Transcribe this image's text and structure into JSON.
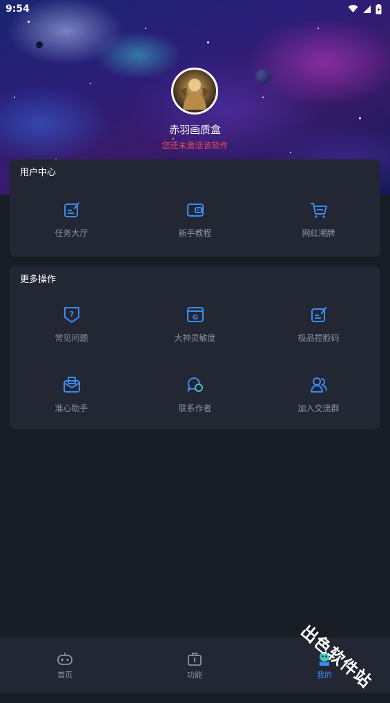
{
  "status_bar": {
    "time": "9:54",
    "icons": [
      "wifi-icon",
      "signal-icon",
      "battery-icon"
    ]
  },
  "profile": {
    "name": "赤羽画质盒",
    "subtitle": "您还未激活该软件"
  },
  "user_center": {
    "title": "用户中心",
    "items": [
      {
        "label": "任务大厅",
        "icon": "task-edit-icon"
      },
      {
        "label": "新手教程",
        "icon": "wallet-icon"
      },
      {
        "label": "网红潮牌",
        "icon": "cart-icon"
      }
    ]
  },
  "more_actions": {
    "title": "更多操作",
    "items": [
      {
        "label": "常见问题",
        "icon": "question-shield-icon"
      },
      {
        "label": "大神灵敏度",
        "icon": "g-browser-icon"
      },
      {
        "label": "极品捏脸码",
        "icon": "edit-note-icon"
      },
      {
        "label": "准心助手",
        "icon": "mailbox-icon"
      },
      {
        "label": "联系作者",
        "icon": "chat-bubble-icon"
      },
      {
        "label": "加入交流群",
        "icon": "group-users-icon"
      }
    ]
  },
  "bottom_nav": {
    "items": [
      {
        "label": "首页",
        "icon": "gamepad-icon",
        "active": false
      },
      {
        "label": "功能",
        "icon": "toolbox-icon",
        "active": false
      },
      {
        "label": "我的",
        "icon": "profile-mascot-icon",
        "active": true
      }
    ]
  },
  "watermark": "出色软件站",
  "colors": {
    "accent": "#3c8cf2",
    "background": "#181c25",
    "card": "#222733",
    "label": "#8a94a6",
    "warning_text": "#e04a5a"
  }
}
